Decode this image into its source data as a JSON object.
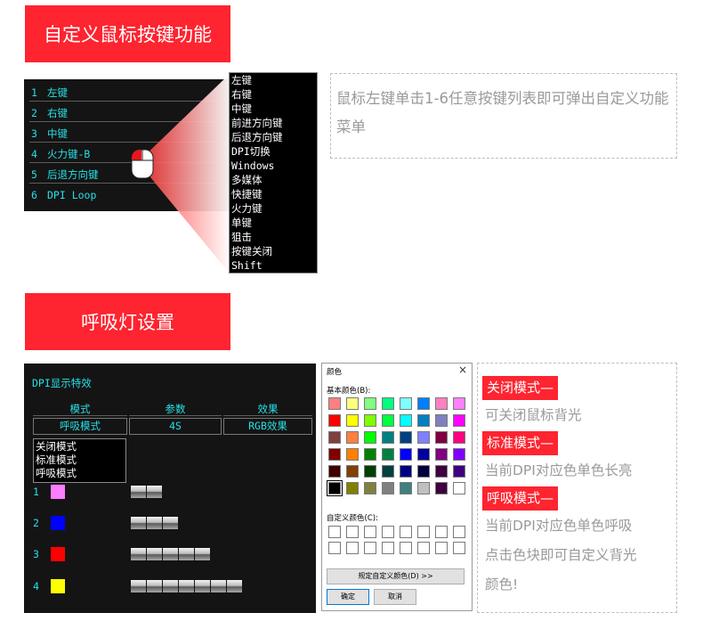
{
  "section1": {
    "title": "自定义鼠标按键功能"
  },
  "key_list": [
    {
      "num": "1",
      "label": "左键"
    },
    {
      "num": "2",
      "label": "右键"
    },
    {
      "num": "3",
      "label": "中键"
    },
    {
      "num": "4",
      "label": "火力键-B"
    },
    {
      "num": "5",
      "label": "后退方向键"
    },
    {
      "num": "6",
      "label": "DPI Loop"
    }
  ],
  "key_menu": [
    "左键",
    "右键",
    "中键",
    "前进方向键",
    "后退方向键",
    "DPI切换",
    "Windows",
    "多媒体",
    "快捷键",
    "火力键",
    "单键",
    "狙击",
    "按键关闭",
    "Shift"
  ],
  "note1": "鼠标左键单击1-6任意按键列表即可弹出自定义功能菜单",
  "section2": {
    "title": "呼吸灯设置"
  },
  "dpi_panel": {
    "title": "DPI显示特效",
    "headers": {
      "mode": "模式",
      "param": "参数",
      "effect": "效果"
    },
    "values": {
      "mode": "呼吸模式",
      "param": "4S",
      "effect": "RGB效果"
    },
    "mode_options": [
      "关闭模式",
      "标准模式",
      "呼吸模式"
    ],
    "levels": [
      {
        "num": "1",
        "color": "#ff7dff",
        "bars": 2
      },
      {
        "num": "2",
        "color": "#0000ff",
        "bars": 3
      },
      {
        "num": "3",
        "color": "#ff0000",
        "bars": 5
      },
      {
        "num": "4",
        "color": "#ffff00",
        "bars": 7
      }
    ]
  },
  "color_dialog": {
    "title": "颜色",
    "close": "×",
    "basic_label": "基本颜色(B):",
    "custom_label": "自定义颜色(C):",
    "define_button": "规定自定义颜色(D) >>",
    "ok_button": "确定",
    "cancel_button": "取消",
    "basic_colors": [
      [
        "#ff8080",
        "#ffff80",
        "#80ff80",
        "#00ff80",
        "#80ffff",
        "#0080ff",
        "#ff80c0",
        "#ff80ff"
      ],
      [
        "#ff0000",
        "#ffff00",
        "#80ff00",
        "#00ff40",
        "#00ffff",
        "#0080c0",
        "#8080c0",
        "#ff00ff"
      ],
      [
        "#804040",
        "#ff8040",
        "#00ff00",
        "#008080",
        "#004080",
        "#8080ff",
        "#800040",
        "#ff0080"
      ],
      [
        "#800000",
        "#ff8000",
        "#008000",
        "#008040",
        "#0000ff",
        "#0000a0",
        "#800080",
        "#8000ff"
      ],
      [
        "#400000",
        "#804000",
        "#004000",
        "#004040",
        "#000080",
        "#000040",
        "#400040",
        "#400080"
      ],
      [
        "#000000",
        "#808000",
        "#808040",
        "#808080",
        "#408080",
        "#c0c0c0",
        "#400040",
        "#ffffff"
      ]
    ]
  },
  "note2": {
    "items": [
      {
        "tag": "关闭模式—",
        "desc": [
          "可关闭鼠标背光"
        ]
      },
      {
        "tag": "标准模式—",
        "desc": [
          "当前DPI对应色单色长亮"
        ]
      },
      {
        "tag": "呼吸模式—",
        "desc": [
          "当前DPI对应色单色呼吸",
          "点击色块即可自定义背光",
          "颜色!"
        ]
      }
    ]
  }
}
